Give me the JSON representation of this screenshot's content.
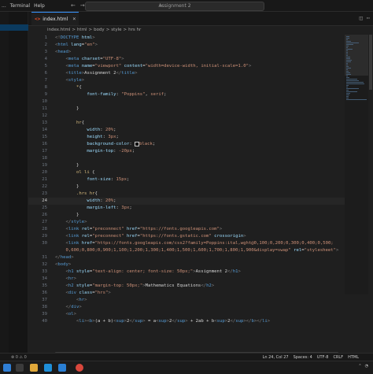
{
  "menu": [
    "...",
    "Terminal",
    "Help"
  ],
  "command_center": "Assignment 2",
  "tab": {
    "name": "index.html",
    "close": "×"
  },
  "breadcrumb": [
    "index.html",
    ">",
    "html",
    ">",
    "body",
    ">",
    "style",
    ">",
    "hrs hr"
  ],
  "editor": {
    "current_line": 24,
    "lines": [
      {
        "n": "1",
        "html": "<span class='t-punct'>&lt;!</span><span class='t-tag'>DOCTYPE</span> <span class='t-attr'>html</span><span class='t-punct'>&gt;</span>"
      },
      {
        "n": "2",
        "html": "<span class='t-punct'>&lt;</span><span class='t-tag'>html</span> <span class='t-attr'>lang</span>=<span class='t-str'>\"en\"</span><span class='t-punct'>&gt;</span>"
      },
      {
        "n": "3",
        "html": "<span class='t-punct'>&lt;</span><span class='t-tag'>head</span><span class='t-punct'>&gt;</span>"
      },
      {
        "n": "4",
        "html": "    <span class='t-punct'>&lt;</span><span class='t-tag'>meta</span> <span class='t-attr'>charset</span>=<span class='t-str'>\"UTF-8\"</span><span class='t-punct'>&gt;</span>"
      },
      {
        "n": "5",
        "html": "    <span class='t-punct'>&lt;</span><span class='t-tag'>meta</span> <span class='t-attr'>name</span>=<span class='t-str'>\"viewport\"</span> <span class='t-attr'>content</span>=<span class='t-str'>\"width=device-width, initial-scale=1.0\"</span><span class='t-punct'>&gt;</span>"
      },
      {
        "n": "6",
        "html": "    <span class='t-punct'>&lt;</span><span class='t-tag'>title</span><span class='t-punct'>&gt;</span><span class='t-text'>Assignment 2</span><span class='t-punct'>&lt;/</span><span class='t-tag'>title</span><span class='t-punct'>&gt;</span>"
      },
      {
        "n": "7",
        "html": "    <span class='t-punct'>&lt;</span><span class='t-tag'>style</span><span class='t-punct'>&gt;</span>"
      },
      {
        "n": "8",
        "html": "        <span class='t-sel'>*</span><span class='t-text'>{</span>"
      },
      {
        "n": "9",
        "html": "            <span class='t-attr'>font-family</span>: <span class='t-str'>\"Poppins\"</span>, <span class='t-str'>serif</span>;"
      },
      {
        "n": "10",
        "html": ""
      },
      {
        "n": "11",
        "html": "        <span class='t-text'>}</span>"
      },
      {
        "n": "12",
        "html": ""
      },
      {
        "n": "13",
        "html": "        <span class='t-sel'>hr</span><span class='t-text'>{</span>"
      },
      {
        "n": "14",
        "html": "            <span class='t-attr'>width</span>: <span class='t-str'>20%</span>;"
      },
      {
        "n": "15",
        "html": "            <span class='t-attr'>height</span>: <span class='t-str'>3px</span>;"
      },
      {
        "n": "16",
        "html": "            <span class='t-attr'>background-color</span>: <span class='swatch'></span><span class='t-str'>black</span>;"
      },
      {
        "n": "17",
        "html": "            <span class='t-attr'>margin-top</span>: <span class='t-str'>-20px</span>;"
      },
      {
        "n": "18",
        "html": ""
      },
      {
        "n": "19",
        "html": "        <span class='t-text'>}</span>"
      },
      {
        "n": "20",
        "html": "        <span class='t-sel'>ol li</span> <span class='t-text'>{</span>"
      },
      {
        "n": "21",
        "html": "            <span class='t-attr'>font-size</span>: <span class='t-str'>15px</span>;"
      },
      {
        "n": "22",
        "html": "        <span class='t-text'>}</span>"
      },
      {
        "n": "23",
        "html": "        <span class='t-sel'>.hrs hr</span><span class='t-text'>{</span>"
      },
      {
        "n": "24",
        "html": "            <span class='t-attr'>width</span>: <span class='t-str'>20%</span>;"
      },
      {
        "n": "25",
        "html": "            <span class='t-attr'>margin-left</span>: <span class='t-str'>3px</span>;"
      },
      {
        "n": "26",
        "html": "        <span class='t-text'>}</span>"
      },
      {
        "n": "27",
        "html": "    <span class='t-punct'>&lt;/</span><span class='t-tag'>style</span><span class='t-punct'>&gt;</span>"
      },
      {
        "n": "28",
        "html": "    <span class='t-punct'>&lt;</span><span class='t-tag'>link</span> <span class='t-attr'>rel</span>=<span class='t-str'>\"preconnect\"</span> <span class='t-attr'>href</span>=<span class='t-str'>\"https://fonts.googleapis.com\"</span><span class='t-punct'>&gt;</span>"
      },
      {
        "n": "29",
        "html": "    <span class='t-punct'>&lt;</span><span class='t-tag'>link</span> <span class='t-attr'>rel</span>=<span class='t-str'>\"preconnect\"</span> <span class='t-attr'>href</span>=<span class='t-str'>\"https://fonts.gstatic.com\"</span> <span class='t-attr'>crossorigin</span><span class='t-punct'>&gt;</span>"
      },
      {
        "n": "30",
        "html": "    <span class='t-punct'>&lt;</span><span class='t-tag'>link</span> <span class='t-attr'>href</span>=<span class='t-str'>\"https://fonts.googleapis.com/css2?family=Poppins:ital,wght@0,100;0,200;0,300;0,400;0,500;</span>"
      },
      {
        "n": "",
        "html": "    <span class='t-str'>0,600;0,800;0,900;1,100;1,200;1,300;1,400;1,500;1,600;1,700;1,800;1,900&amp;display=swap\"</span> <span class='t-attr'>rel</span>=<span class='t-str'>\"stylesheet\"</span><span class='t-punct'>&gt;</span>"
      },
      {
        "n": "31",
        "html": "<span class='t-punct'>&lt;/</span><span class='t-tag'>head</span><span class='t-punct'>&gt;</span>"
      },
      {
        "n": "32",
        "html": "<span class='t-punct'>&lt;</span><span class='t-tag'>body</span><span class='t-punct'>&gt;</span>"
      },
      {
        "n": "33",
        "html": "    <span class='t-punct'>&lt;</span><span class='t-tag'>h1</span> <span class='t-attr'>style</span>=<span class='t-str'>\"text-align: center; font-size: 50px;\"</span><span class='t-punct'>&gt;</span><span class='t-text'>Assignment 2</span><span class='t-punct'>&lt;/</span><span class='t-tag'>h1</span><span class='t-punct'>&gt;</span>"
      },
      {
        "n": "34",
        "html": "    <span class='t-punct'>&lt;</span><span class='t-tag'>hr</span><span class='t-punct'>&gt;</span>"
      },
      {
        "n": "35",
        "html": "    <span class='t-punct'>&lt;</span><span class='t-tag'>h2</span> <span class='t-attr'>style</span>=<span class='t-str'>\"margin-top: 50px;\"</span><span class='t-punct'>&gt;</span><span class='t-text'>Mathematics Equations</span><span class='t-punct'>&lt;/</span><span class='t-tag'>h2</span><span class='t-punct'>&gt;</span>"
      },
      {
        "n": "36",
        "html": "    <span class='t-punct'>&lt;</span><span class='t-tag'>div</span> <span class='t-attr'>class</span>=<span class='t-str'>\"hrs\"</span><span class='t-punct'>&gt;</span>"
      },
      {
        "n": "37",
        "html": "        <span class='t-punct'>&lt;</span><span class='t-tag'>hr</span><span class='t-punct'>&gt;</span>"
      },
      {
        "n": "38",
        "html": "    <span class='t-punct'>&lt;/</span><span class='t-tag'>div</span><span class='t-punct'>&gt;</span>"
      },
      {
        "n": "39",
        "html": "    <span class='t-punct'>&lt;</span><span class='t-tag'>ol</span><span class='t-punct'>&gt;</span>"
      },
      {
        "n": "40",
        "html": "        <span class='t-punct'>&lt;</span><span class='t-tag'>li</span><span class='t-punct'>&gt;&lt;</span><span class='t-tag'>b</span><span class='t-punct'>&gt;</span><span class='t-text'>(a + b)</span><span class='t-punct'>&lt;</span><span class='t-tag'>sup</span><span class='t-punct'>&gt;</span><span class='t-text'>2</span><span class='t-punct'>&lt;/</span><span class='t-tag'>sup</span><span class='t-punct'>&gt;</span><span class='t-text'> = a</span><span class='t-punct'>&lt;</span><span class='t-tag'>sup</span><span class='t-punct'>&gt;</span><span class='t-text'>2</span><span class='t-punct'>&lt;/</span><span class='t-tag'>sup</span><span class='t-punct'>&gt;</span><span class='t-text'> + 2ab + b</span><span class='t-punct'>&lt;</span><span class='t-tag'>sup</span><span class='t-punct'>&gt;</span><span class='t-text'>2</span><span class='t-punct'>&lt;/</span><span class='t-tag'>sup</span><span class='t-punct'>&gt;&lt;/</span><span class='t-tag'>b</span><span class='t-punct'>&gt;&lt;/</span><span class='t-tag'>li</span><span class='t-punct'>&gt;</span>"
      }
    ]
  },
  "status": {
    "left": "⊗ 0 ⚠ 0",
    "ln_col": "Ln 24, Col 27",
    "spaces": "Spaces: 4",
    "encoding": "UTF-8",
    "eol": "CRLF",
    "language": "HTML"
  },
  "taskbar": {
    "time": "",
    "icons": [
      "windows-icon",
      "search-icon",
      "folder-icon",
      "edge-icon",
      "vscode-icon",
      "chrome-icon"
    ]
  }
}
